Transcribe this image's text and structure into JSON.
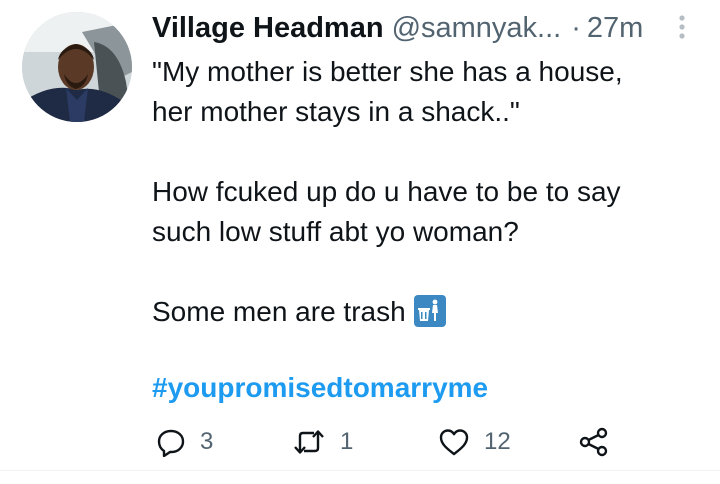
{
  "tweet": {
    "author_name": "Village Headman",
    "author_handle": "@samnyak...",
    "separator": "·",
    "time": "27m",
    "lines": [
      "\"My mother is better she has a house,",
      "her mother stays in a shack..\"",
      "How fcuked up do u have to be to say",
      "such low stuff abt yo woman?",
      "Some men are trash"
    ],
    "emoji": "trash-can-emoji",
    "hashtag": "#youpromisedtomarryme"
  },
  "actions": {
    "replies": "3",
    "retweets": "1",
    "likes": "12"
  },
  "colors": {
    "text": "#0f1419",
    "secondary": "#536471",
    "link": "#1d9bf0",
    "emoji_bg": "#3b88c3"
  }
}
